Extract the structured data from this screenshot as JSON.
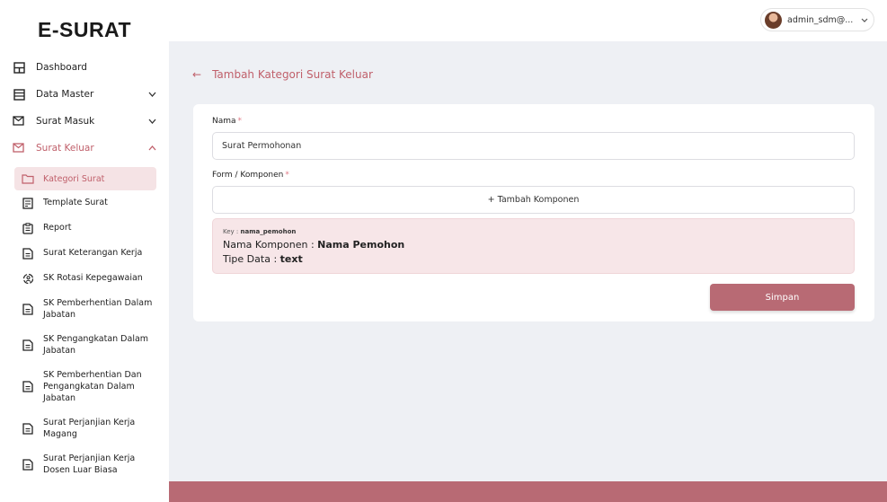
{
  "brand": "E-SURAT",
  "user": {
    "name": "admin_sdm@..."
  },
  "nav": {
    "items": [
      {
        "label": "Dashboard",
        "icon": "dashboard-icon"
      },
      {
        "label": "Data Master",
        "icon": "table-icon"
      },
      {
        "label": "Surat Masuk",
        "icon": "mail-in-icon"
      },
      {
        "label": "Surat Keluar",
        "icon": "mail-out-icon"
      }
    ],
    "sub_items": [
      {
        "label": "Kategori Surat",
        "icon": "folder-icon"
      },
      {
        "label": "Template Surat",
        "icon": "template-icon"
      },
      {
        "label": "Report",
        "icon": "report-icon"
      },
      {
        "label": "Surat Keterangan Kerja",
        "icon": "document-icon"
      },
      {
        "label": "SK Rotasi Kepegawaian",
        "icon": "rotation-icon"
      },
      {
        "label": "SK Pemberhentian Dalam\nJabatan",
        "icon": "document-icon"
      },
      {
        "label": "SK Pengangkatan Dalam\nJabatan",
        "icon": "document-icon"
      },
      {
        "label": "SK Pemberhentian Dan\nPengangkatan Dalam\nJabatan",
        "icon": "document-icon"
      },
      {
        "label": "Surat Perjanjian Kerja\nMagang",
        "icon": "document-icon"
      },
      {
        "label": "Surat Perjanjian Kerja\nDosen Luar Biasa",
        "icon": "document-icon"
      }
    ]
  },
  "page": {
    "back": "←",
    "title": "Tambah Kategori Surat Keluar"
  },
  "form": {
    "nama_label": "Nama",
    "nama_value": "Surat Permohonan",
    "komponen_label": "Form / Komponen",
    "required_mark": "*",
    "add_component_label": "+ Tambah Komponen",
    "component": {
      "key_prefix": "Key : ",
      "key": "nama_pemohon",
      "name_prefix": "Nama Komponen : ",
      "name": "Nama Pemohon",
      "type_prefix": "Tipe Data : ",
      "type": "text"
    },
    "save_label": "Simpan"
  },
  "colors": {
    "accent": "#c0606b",
    "button": "#b86a74",
    "active_bg": "#f5e3e5",
    "component_bg": "#f7e6e8",
    "main_bg": "#eef0f4"
  }
}
